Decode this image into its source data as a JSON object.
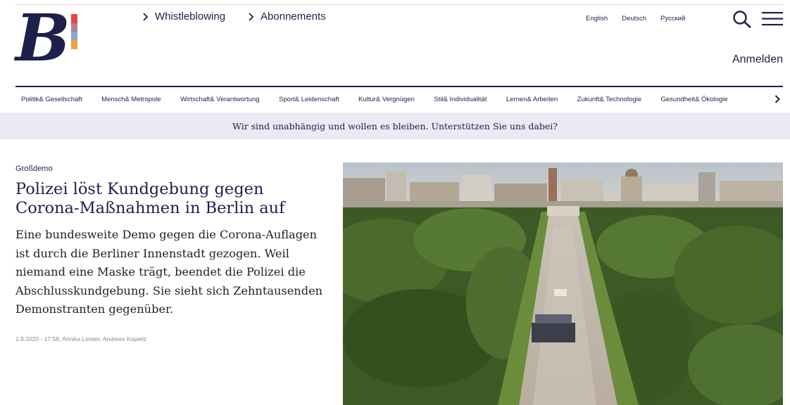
{
  "header": {
    "logo_text": "B",
    "primary_nav": [
      {
        "label": "Whistleblowing"
      },
      {
        "label": "Abonnements"
      }
    ],
    "languages": [
      {
        "label": "English"
      },
      {
        "label": "Deutsch"
      },
      {
        "label": "Русский"
      }
    ],
    "login_label": "Anmelden",
    "search_icon": "search-icon",
    "menu_icon": "hamburger-menu-icon"
  },
  "sections": [
    {
      "label": "Politik& Gesellschaft"
    },
    {
      "label": "Mensch& Metropole"
    },
    {
      "label": "Wirtschaft& Verantwortung"
    },
    {
      "label": "Sport& Leidenschaft"
    },
    {
      "label": "Kultur& Vergnügen"
    },
    {
      "label": "Stil& Individualität"
    },
    {
      "label": "Lernen& Arbeiten"
    },
    {
      "label": "Zukunft& Technologie"
    },
    {
      "label": "Gesundheit& Ökologie"
    }
  ],
  "banner": {
    "text": "Wir sind unabhängig und wollen es bleiben. Unterstützen Sie uns dabei?"
  },
  "article": {
    "kicker": "Großdemo",
    "headline": "Polizei löst Kundgebung gegen Corona-Maßnahmen in Berlin auf",
    "lead": "Eine bundesweite Demo gegen die Corona-Auflagen ist durch die Berliner Innenstadt gezogen. Weil niemand eine Maske trägt, beendet die Polizei die Abschlusskundgebung. Sie sieht sich Zehntausenden Demonstranten gegenüber.",
    "meta": "1.8.2020 - 17:58, Annika Leister, Andreas Kopietz"
  },
  "colors": {
    "brand": "#1e1f4a",
    "banner_bg": "#ebe9f3",
    "logo_stripes": [
      "#e8453c",
      "#8ea6d8",
      "#f0a13b"
    ]
  }
}
